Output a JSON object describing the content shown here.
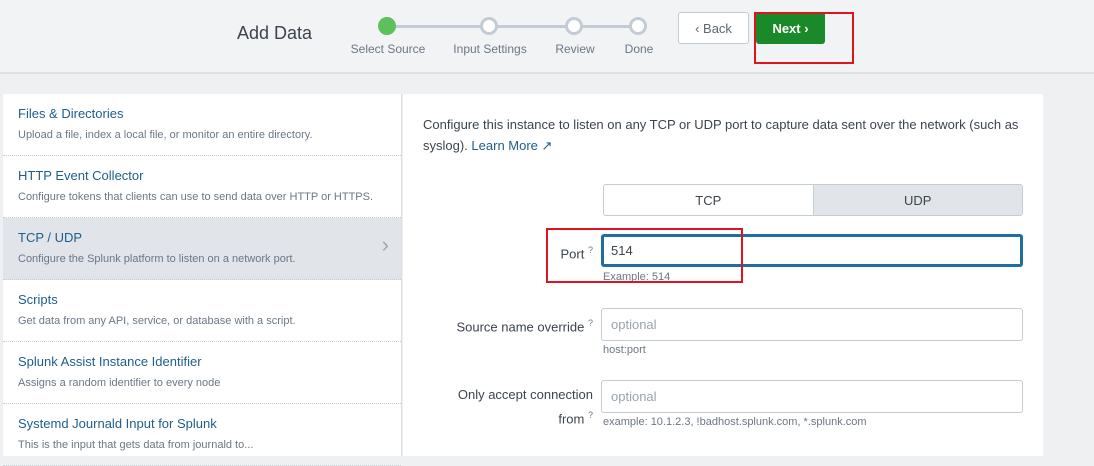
{
  "header": {
    "title": "Add Data",
    "steps": [
      "Select Source",
      "Input Settings",
      "Review",
      "Done"
    ],
    "back": "‹ Back",
    "next": "Next ›"
  },
  "sidebar": {
    "items": [
      {
        "title": "Files & Directories",
        "desc": "Upload a file, index a local file, or monitor an entire directory."
      },
      {
        "title": "HTTP Event Collector",
        "desc": "Configure tokens that clients can use to send data over HTTP or HTTPS."
      },
      {
        "title": "TCP / UDP",
        "desc": "Configure the Splunk platform to listen on a network port."
      },
      {
        "title": "Scripts",
        "desc": "Get data from any API, service, or database with a script."
      },
      {
        "title": "Splunk Assist Instance Identifier",
        "desc": "Assigns a random identifier to every node"
      },
      {
        "title": "Systemd Journald Input for Splunk",
        "desc": "This is the input that gets data from journald to..."
      }
    ]
  },
  "main": {
    "intro": "Configure this instance to listen on any TCP or UDP port to capture data sent over the network (such as syslog).",
    "learn_more": "Learn More ↗",
    "protocols": [
      "TCP",
      "UDP"
    ],
    "port": {
      "label": "Port",
      "value": "514",
      "help": "Example: 514"
    },
    "source": {
      "label": "Source name override",
      "placeholder": "optional",
      "help": "host:port"
    },
    "accept": {
      "label": "Only accept connection from",
      "placeholder": "optional",
      "help": "example: 10.1.2.3, !badhost.splunk.com, *.splunk.com"
    },
    "help_mark": "?"
  }
}
